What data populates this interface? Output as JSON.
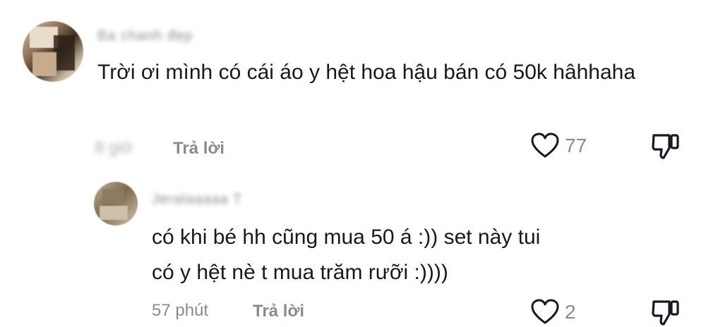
{
  "comments": [
    {
      "username": "Ba chanh đẹp",
      "text": "Trời ơi mình có cái áo y hệt hoa hậu bán có 50k hâhhaha",
      "time": "8 giờ",
      "reply_label": "Trả lời",
      "likes": "77"
    },
    {
      "username": "Jeralaaaaa T",
      "text": "có khi bé hh cũng mua 50 á :)) set này tui có y hệt nè t mua trăm rưỡi :))))",
      "time": "57 phút",
      "reply_label": "Trả lời",
      "likes": "2"
    }
  ],
  "colors": {
    "text": "#161823",
    "muted": "#8a8b91",
    "background": "#ffffff"
  },
  "icons": [
    "heart-icon",
    "dislike-icon"
  ]
}
